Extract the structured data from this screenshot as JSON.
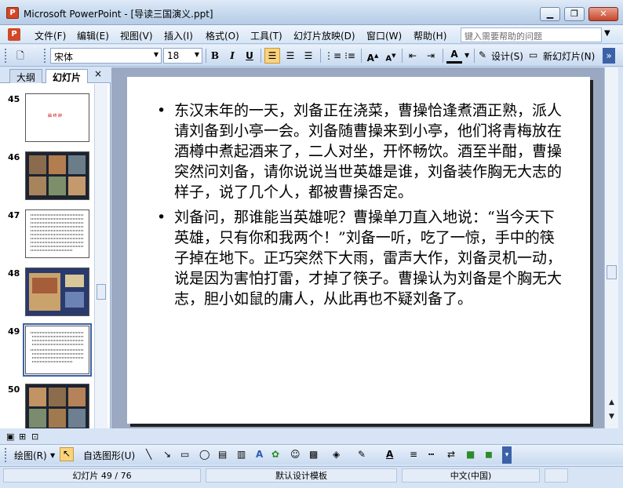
{
  "window": {
    "title": "Microsoft PowerPoint - [导读三国演义.ppt]",
    "minimize": "▁",
    "maximize": "❐",
    "close": "✕"
  },
  "menu": {
    "items": [
      "文件(F)",
      "编辑(E)",
      "视图(V)",
      "插入(I)",
      "格式(O)",
      "工具(T)",
      "幻灯片放映(D)",
      "窗口(W)",
      "帮助(H)"
    ],
    "help_placeholder": "键入需要帮助的问题"
  },
  "toolbar": {
    "font_name": "宋体",
    "font_size": "18",
    "bold": "B",
    "italic": "I",
    "underline": "U",
    "design_label": "设计(S)",
    "new_slide_label": "新幻灯片(N)"
  },
  "left_panel": {
    "tab_outline": "大纲",
    "tab_slides": "幻灯片",
    "close": "×",
    "thumbnails": [
      {
        "number": "45",
        "kind": "title",
        "title_text": "曲 终 醉"
      },
      {
        "number": "46",
        "kind": "comic"
      },
      {
        "number": "47",
        "kind": "text"
      },
      {
        "number": "48",
        "kind": "cover"
      },
      {
        "number": "49",
        "kind": "text",
        "selected": true
      },
      {
        "number": "50",
        "kind": "comic"
      }
    ]
  },
  "slide": {
    "bullets": [
      "东汉末年的一天，刘备正在浇菜，曹操恰逢煮酒正熟，派人请刘备到小亭一会。刘备随曹操来到小亭，他们将青梅放在酒樽中煮起酒来了，二人对坐，开怀畅饮。酒至半酣，曹操突然问刘备，请你说说当世英雄是谁，刘备装作胸无大志的样子，说了几个人，都被曹操否定。",
      "刘备问，那谁能当英雄呢？曹操单刀直入地说：“当今天下英雄，只有你和我两个！”刘备一听，吃了一惊，手中的筷子掉在地下。正巧突然下大雨，雷声大作，刘备灵机一动，说是因为害怕打雷，才掉了筷子。曹操认为刘备是个胸无大志，胆小如鼠的庸人，从此再也不疑刘备了。"
    ]
  },
  "drawbar": {
    "draw_label": "绘图(R)",
    "autoshapes_label": "自选图形(U)"
  },
  "status": {
    "slide_position": "幻灯片 49 / 76",
    "design_template": "默认设计模板",
    "language": "中文(中国)"
  }
}
